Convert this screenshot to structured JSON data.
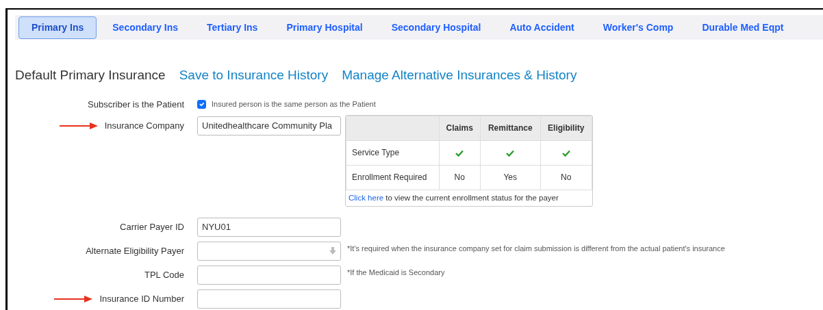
{
  "tabs": [
    {
      "label": "Primary Ins",
      "selected": true
    },
    {
      "label": "Secondary Ins",
      "selected": false
    },
    {
      "label": "Tertiary Ins",
      "selected": false
    },
    {
      "label": "Primary Hospital",
      "selected": false
    },
    {
      "label": "Secondary Hospital",
      "selected": false
    },
    {
      "label": "Auto Accident",
      "selected": false
    },
    {
      "label": "Worker's Comp",
      "selected": false
    },
    {
      "label": "Durable Med Eqpt",
      "selected": false
    }
  ],
  "heading": {
    "title": "Default Primary Insurance",
    "links": [
      "Save to Insurance History",
      "Manage Alternative Insurances & History"
    ]
  },
  "fields": [
    {
      "kind": "checkbox",
      "label": "Subscriber is the Patient",
      "checked": true,
      "text": "Insured person is the same person as the Patient",
      "arrow": false
    },
    {
      "kind": "text",
      "label": "Insurance Company",
      "value": "Unitedhealthcare Community Pla",
      "arrow": true
    },
    {
      "kind": "text",
      "label": "Carrier Payer ID",
      "value": "NYU01",
      "arrow": false
    },
    {
      "kind": "select",
      "label": "Alternate Eligibility Payer",
      "note": "*It's required when the insurance company set for claim submission is different from the actual patient's insurance",
      "arrow": false
    },
    {
      "kind": "text",
      "label": "TPL Code",
      "note": "*If the Medicaid is Secondary",
      "arrow": false
    },
    {
      "kind": "text",
      "label": "Insurance ID Number",
      "arrow": true
    }
  ],
  "enrollment_table": {
    "columns": [
      "Claims",
      "Remittance",
      "Eligibility"
    ],
    "rows": [
      {
        "label": "Service Type",
        "cells": [
          {
            "kind": "check"
          },
          {
            "kind": "check"
          },
          {
            "kind": "check"
          }
        ]
      },
      {
        "label": "Enrollment Required",
        "cells": [
          {
            "kind": "text",
            "text": "No"
          },
          {
            "kind": "text",
            "text": "Yes"
          },
          {
            "kind": "text",
            "text": "No"
          }
        ]
      }
    ],
    "footer": {
      "link": "Click here",
      "text": "to view the current enrollment status for the payer"
    }
  }
}
